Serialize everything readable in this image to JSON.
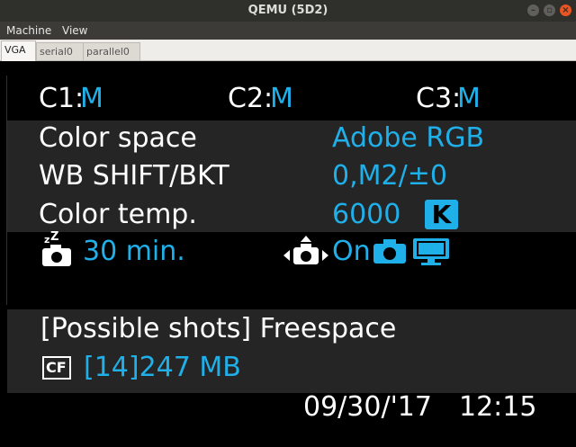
{
  "window": {
    "title": "QEMU (5D2)"
  },
  "menubar": {
    "items": [
      "Machine",
      "View"
    ]
  },
  "tabs": [
    {
      "label": "VGA",
      "active": true
    },
    {
      "label": "serial0",
      "active": false
    },
    {
      "label": "parallel0",
      "active": false
    }
  ],
  "camera": {
    "custom_modes": [
      {
        "label": "C1:",
        "value": "M"
      },
      {
        "label": "C2:",
        "value": "M"
      },
      {
        "label": "C3:",
        "value": "M"
      }
    ],
    "settings": [
      {
        "label": "Color space",
        "value": "Adobe RGB"
      },
      {
        "label": "WB SHIFT/BKT",
        "value": "0,M2/±0"
      },
      {
        "label": "Color temp.",
        "value": "6000",
        "badge": "K"
      }
    ],
    "auto_power_off": "30 min.",
    "live_view": "On",
    "possible_shots": "[Possible shots] Freespace",
    "card_label": "CF",
    "card_info": "[14]247 MB",
    "date": "09/30/'17",
    "time": "12:15"
  },
  "colors": {
    "accent": "#1fb0ea",
    "band": "#252525",
    "titlebar": "#2f2f2c",
    "menubar": "#3c3b37"
  },
  "icons": [
    "minimize-icon",
    "maximize-icon",
    "close-icon",
    "sleep-camera-icon",
    "live-view-camera-icon",
    "camera-icon",
    "monitor-icon",
    "cf-card-icon"
  ]
}
